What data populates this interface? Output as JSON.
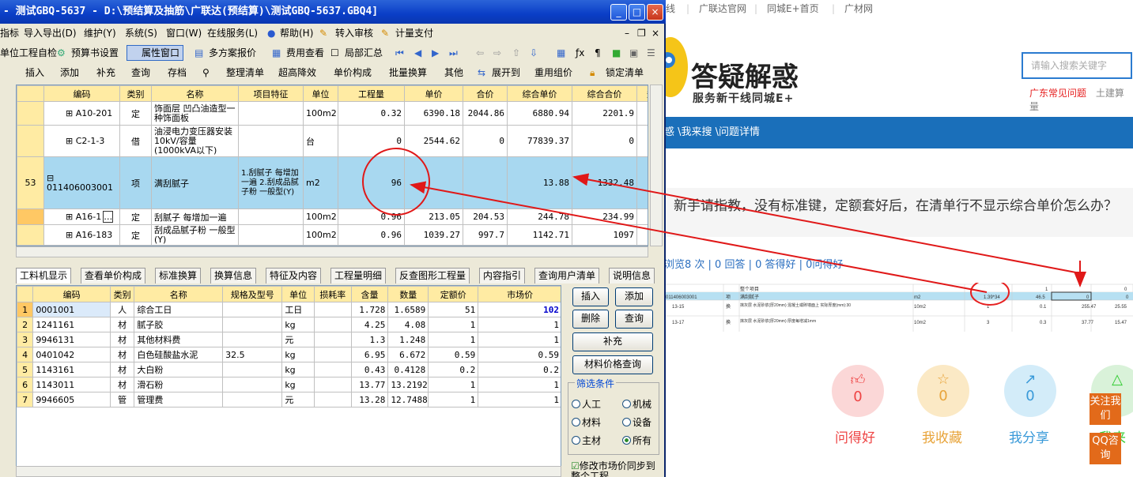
{
  "app": {
    "title": "- 测试GBQ-5637 - D:\\预结算及抽筋\\广联达(预结算)\\测试GBQ-5637.GBQ4]",
    "menu": [
      "指标",
      "导入导出(D)",
      "维护(Y)",
      "系统(S)",
      "窗口(W)",
      "在线服务(L)",
      "帮助(H)",
      "转入审核",
      "计量支付"
    ],
    "toolbar1": [
      "单位工程自检",
      "预算书设置",
      "属性窗口",
      "多方案报价",
      "费用查看",
      "局部汇总"
    ],
    "toolbar2": [
      "插入",
      "添加",
      "补充",
      "查询",
      "存档",
      "整理清单",
      "超高降效",
      "单价构成",
      "批量换算",
      "其他",
      "展开到",
      "重用组价",
      "锁定清单"
    ],
    "upper_headers": [
      "编码",
      "类别",
      "名称",
      "项目特征",
      "单位",
      "工程量",
      "单价",
      "合价",
      "综合单价",
      "综合合价",
      "规"
    ],
    "upper_rows": [
      {
        "no": "",
        "code": "A10-201",
        "type": "定",
        "name": "饰面层 凹凸油造型一种饰面板",
        "feature": "",
        "unit": "100m2",
        "qty": "0.32",
        "price": "6390.18",
        "total": "2044.86",
        "uprice": "6880.94",
        "utotal": "2201.9"
      },
      {
        "no": "",
        "code": "C2-1-3",
        "type": "借",
        "name": "油浸电力变压器安装 10kV/容量(1000kVA以下)",
        "feature": "",
        "unit": "台",
        "qty": "0",
        "price": "2544.62",
        "total": "0",
        "uprice": "77839.37",
        "utotal": "0"
      },
      {
        "no": "53",
        "code": "011406003001",
        "type": "项",
        "name": "满刮腻子",
        "feature": "1.刮腻子 每增加一遍 2.刮成品腻子粉 一般型(Y)",
        "unit": "m2",
        "qty": "96",
        "price": "",
        "total": "",
        "uprice": "13.88",
        "utotal": "1332.48"
      },
      {
        "no": "",
        "code": "A16-1",
        "type": "定",
        "name": "刮腻子 每增加一遍",
        "feature": "",
        "unit": "100m2",
        "qty": "0.96",
        "price": "213.05",
        "total": "204.53",
        "uprice": "244.78",
        "utotal": "234.99"
      },
      {
        "no": "",
        "code": "A16-183",
        "type": "定",
        "name": "刮成品腻子粉 一般型(Y)",
        "feature": "",
        "unit": "100m2",
        "qty": "0.96",
        "price": "1039.27",
        "total": "997.7",
        "uprice": "1142.71",
        "utotal": "1097"
      }
    ],
    "tabs": [
      "工料机显示",
      "查看单价构成",
      "标准换算",
      "换算信息",
      "特征及内容",
      "工程量明细",
      "反查图形工程量",
      "内容指引",
      "查询用户清单",
      "说明信息"
    ],
    "lower_headers": [
      "编码",
      "类别",
      "名称",
      "规格及型号",
      "单位",
      "损耗率",
      "含量",
      "数量",
      "定额价",
      "市场价"
    ],
    "lower_rows": [
      {
        "no": "1",
        "code": "0001001",
        "type": "人",
        "name": "综合工日",
        "spec": "",
        "unit": "工日",
        "loss": "",
        "content": "1.728",
        "qty": "1.6589",
        "fixed": "51",
        "market": "102"
      },
      {
        "no": "2",
        "code": "1241161",
        "type": "材",
        "name": "腻子胶",
        "spec": "",
        "unit": "kg",
        "loss": "",
        "content": "4.25",
        "qty": "4.08",
        "fixed": "1",
        "market": "1"
      },
      {
        "no": "3",
        "code": "9946131",
        "type": "材",
        "name": "其他材料费",
        "spec": "",
        "unit": "元",
        "loss": "",
        "content": "1.3",
        "qty": "1.248",
        "fixed": "1",
        "market": "1"
      },
      {
        "no": "4",
        "code": "0401042",
        "type": "材",
        "name": "白色硅酸盐水泥",
        "spec": "32.5",
        "unit": "kg",
        "loss": "",
        "content": "6.95",
        "qty": "6.672",
        "fixed": "0.59",
        "market": "0.59"
      },
      {
        "no": "5",
        "code": "1143161",
        "type": "材",
        "name": "大白粉",
        "spec": "",
        "unit": "kg",
        "loss": "",
        "content": "0.43",
        "qty": "0.4128",
        "fixed": "0.2",
        "market": "0.2"
      },
      {
        "no": "6",
        "code": "1143011",
        "type": "材",
        "name": "滑石粉",
        "spec": "",
        "unit": "kg",
        "loss": "",
        "content": "13.77",
        "qty": "13.2192",
        "fixed": "1",
        "market": "1"
      },
      {
        "no": "7",
        "code": "9946605",
        "type": "管",
        "name": "管理费",
        "spec": "",
        "unit": "元",
        "loss": "",
        "content": "13.28",
        "qty": "12.7488",
        "fixed": "1",
        "market": "1"
      }
    ],
    "buttons": {
      "insert": "插入",
      "add": "添加",
      "delete": "删除",
      "query": "查询",
      "supplement": "补充",
      "price_query": "材料价格查询"
    },
    "filter": {
      "title": "筛选条件",
      "labor": "人工",
      "machine": "机械",
      "material": "材料",
      "equipment": "设备",
      "main": "主材",
      "all": "所有"
    },
    "sync": "修改市场价同步到整个工程"
  },
  "web": {
    "toplinks": [
      "线",
      "广联达官网",
      "同城E+首页",
      "广材网"
    ],
    "logo_title": "答疑解惑",
    "logo_sub": "服务新干线同城E+",
    "search_placeholder": "请输入搜索关键字",
    "hot1": "广东常见问题",
    "hot2": "土建算量",
    "breadcrumb": "惑 \\我来搜 \\问题详情",
    "question": "新手请指教，没有标准键，定额套好后，在清单行不显示综合单价怎么办？",
    "stats": "浏览8 次 | 0 回答 | 0 答得好 | 0问得好",
    "actions": [
      {
        "label": "问得好",
        "count": "0"
      },
      {
        "label": "我收藏",
        "count": "0"
      },
      {
        "label": "我分享",
        "count": "0"
      },
      {
        "label": "我来推",
        "count": ""
      }
    ],
    "side1": "关注我们",
    "side2": "QQ咨询",
    "thumb": {
      "r1": [
        "整个项目",
        "1",
        "0"
      ],
      "r2": [
        "011406003001",
        "项",
        "满刮腻子",
        "m2",
        "1.39*34",
        "46.5",
        "0",
        "0"
      ],
      "r3": [
        "13-15",
        "换",
        "抹灰层 水泥砂浆(厚20mm) 混凝土或砖墙面上 实际厚度(mm):30",
        "10m2",
        "1",
        "0.1",
        "255.47",
        "25.55"
      ],
      "r4": [
        "13-17",
        "换",
        "抹灰层 水泥砂浆(厚20mm) 厚度每增减1mm",
        "10m2",
        "3",
        "0.3",
        "37.77",
        "15.47"
      ]
    },
    "colors": {
      "blue": "#1a6fba",
      "red": "#e62020",
      "orange": "#e26a1a"
    }
  }
}
